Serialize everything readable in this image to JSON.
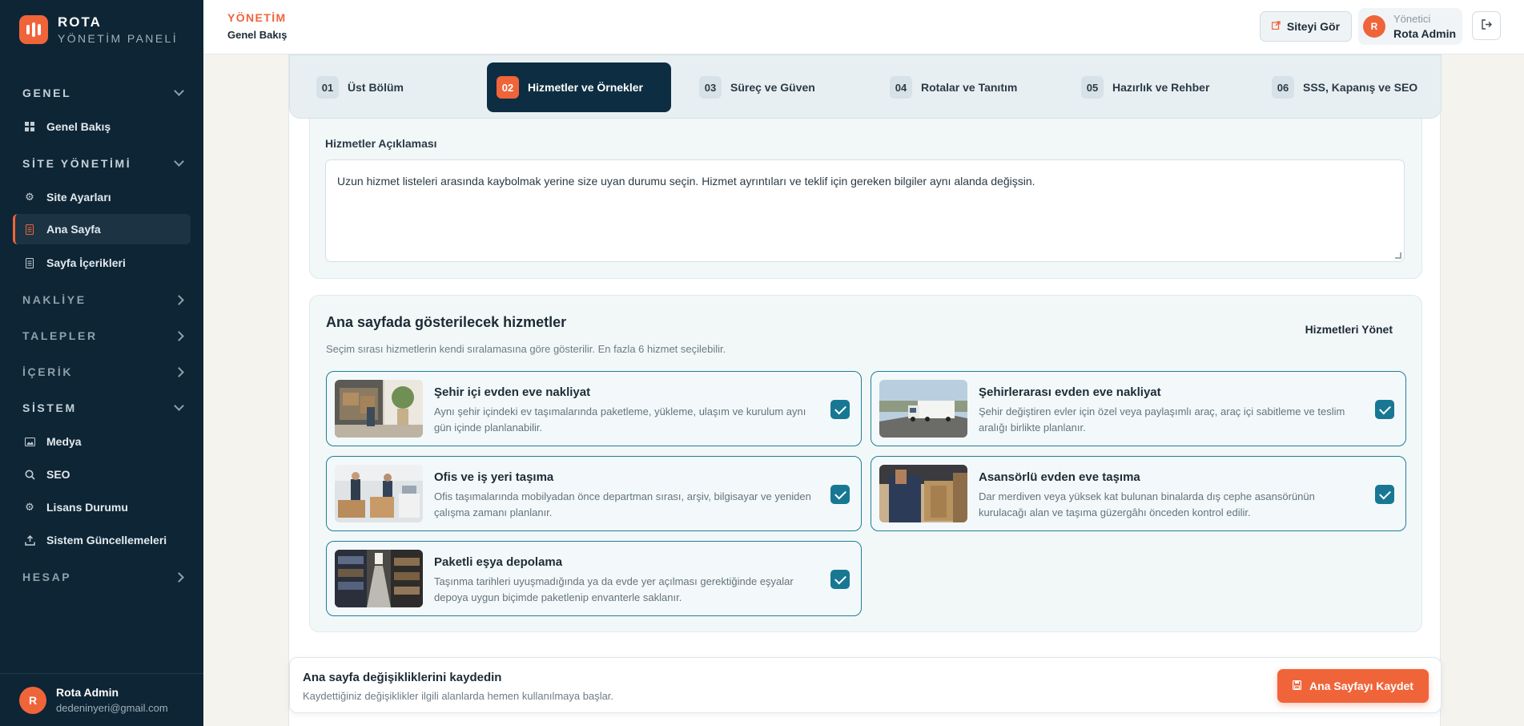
{
  "brand": {
    "name": "ROTA",
    "subtitle": "YÖNETİM PANELİ"
  },
  "sidebar": {
    "sections": [
      {
        "label": "GENEL",
        "state": "open",
        "icon": "chevron-down-icon"
      },
      {
        "label": "SİTE YÖNETİMİ",
        "state": "open",
        "icon": "chevron-down-icon"
      },
      {
        "label": "NAKLİYE",
        "state": "closed",
        "icon": "chevron-right-icon"
      },
      {
        "label": "TALEPLER",
        "state": "closed",
        "icon": "chevron-right-icon"
      },
      {
        "label": "İÇERİK",
        "state": "closed",
        "icon": "chevron-right-icon"
      },
      {
        "label": "SİSTEM",
        "state": "open",
        "icon": "chevron-down-icon"
      },
      {
        "label": "HESAP",
        "state": "closed",
        "icon": "chevron-right-icon"
      }
    ],
    "items": [
      {
        "label": "Genel Bakış",
        "icon": "grid-icon"
      },
      {
        "label": "Site Ayarları",
        "icon": "gear-icon"
      },
      {
        "label": "Ana Sayfa",
        "icon": "document-icon",
        "active": true
      },
      {
        "label": "Sayfa İçerikleri",
        "icon": "document-icon"
      },
      {
        "label": "Medya",
        "icon": "image-icon"
      },
      {
        "label": "SEO",
        "icon": "search-icon"
      },
      {
        "label": "Lisans Durumu",
        "icon": "gear-icon"
      },
      {
        "label": "Sistem Güncellemeleri",
        "icon": "upload-icon"
      }
    ],
    "user": {
      "initial": "R",
      "name": "Rota Admin",
      "email": "dedeninyeri@gmail.com"
    }
  },
  "header": {
    "kicker": "YÖNETİM",
    "title": "Genel Bakış",
    "view_site": "Siteyi Gör",
    "user_role": "Yönetici",
    "user_name": "Rota Admin",
    "user_initial": "R"
  },
  "tabs": [
    {
      "num": "01",
      "label": "Üst Bölüm"
    },
    {
      "num": "02",
      "label": "Hizmetler ve Örnekler",
      "active": true
    },
    {
      "num": "03",
      "label": "Süreç ve Güven"
    },
    {
      "num": "04",
      "label": "Rotalar ve Tanıtım"
    },
    {
      "num": "05",
      "label": "Hazırlık ve Rehber"
    },
    {
      "num": "06",
      "label": "SSS, Kapanış ve SEO"
    }
  ],
  "description": {
    "label": "Hizmetler Açıklaması",
    "value": "Uzun hizmet listeleri arasında kaybolmak yerine size uyan durumu seçin. Hizmet ayrıntıları ve teklif için gereken bilgiler aynı alanda değişsin."
  },
  "services": {
    "title": "Ana sayfada gösterilecek hizmetler",
    "note": "Seçim sırası hizmetlerin kendi sıralamasına göre gösterilir. En fazla 6 hizmet seçilebilir.",
    "manage": "Hizmetleri Yönet",
    "items": [
      {
        "title": "Şehir içi evden eve nakliyat",
        "desc": "Aynı şehir içindeki ev taşımalarında paketleme, yükleme, ulaşım ve kurulum aynı gün içinde planlanabilir.",
        "checked": true
      },
      {
        "title": "Şehirlerarası evden eve nakliyat",
        "desc": "Şehir değiştiren evler için özel veya paylaşımlı araç, araç içi sabitleme ve teslim aralığı birlikte planlanır.",
        "checked": true
      },
      {
        "title": "Ofis ve iş yeri taşıma",
        "desc": "Ofis taşımalarında mobilyadan önce departman sırası, arşiv, bilgisayar ve yeniden çalışma zamanı planlanır.",
        "checked": true
      },
      {
        "title": "Asansörlü evden eve taşıma",
        "desc": "Dar merdiven veya yüksek kat bulunan binalarda dış cephe asansörünün kurulacağı alan ve taşıma güzergâhı önceden kontrol edilir.",
        "checked": true
      },
      {
        "title": "Paketli eşya depolama",
        "desc": "Taşınma tarihleri uyuşmadığında ya da evde yer açılması gerektiğinde eşyalar depoya uygun biçimde paketlenip envanterle saklanır.",
        "checked": true
      }
    ]
  },
  "savebar": {
    "title": "Ana sayfa değişikliklerini kaydedin",
    "subtitle": "Kaydettiğiniz değişiklikler ilgili alanlarda hemen kullanılmaya başlar.",
    "button": "Ana Sayfayı Kaydet"
  },
  "colors": {
    "accent": "#f0643a",
    "sidebar": "#0e2535",
    "active_tab": "#0d2e42",
    "checkbox": "#187893"
  }
}
